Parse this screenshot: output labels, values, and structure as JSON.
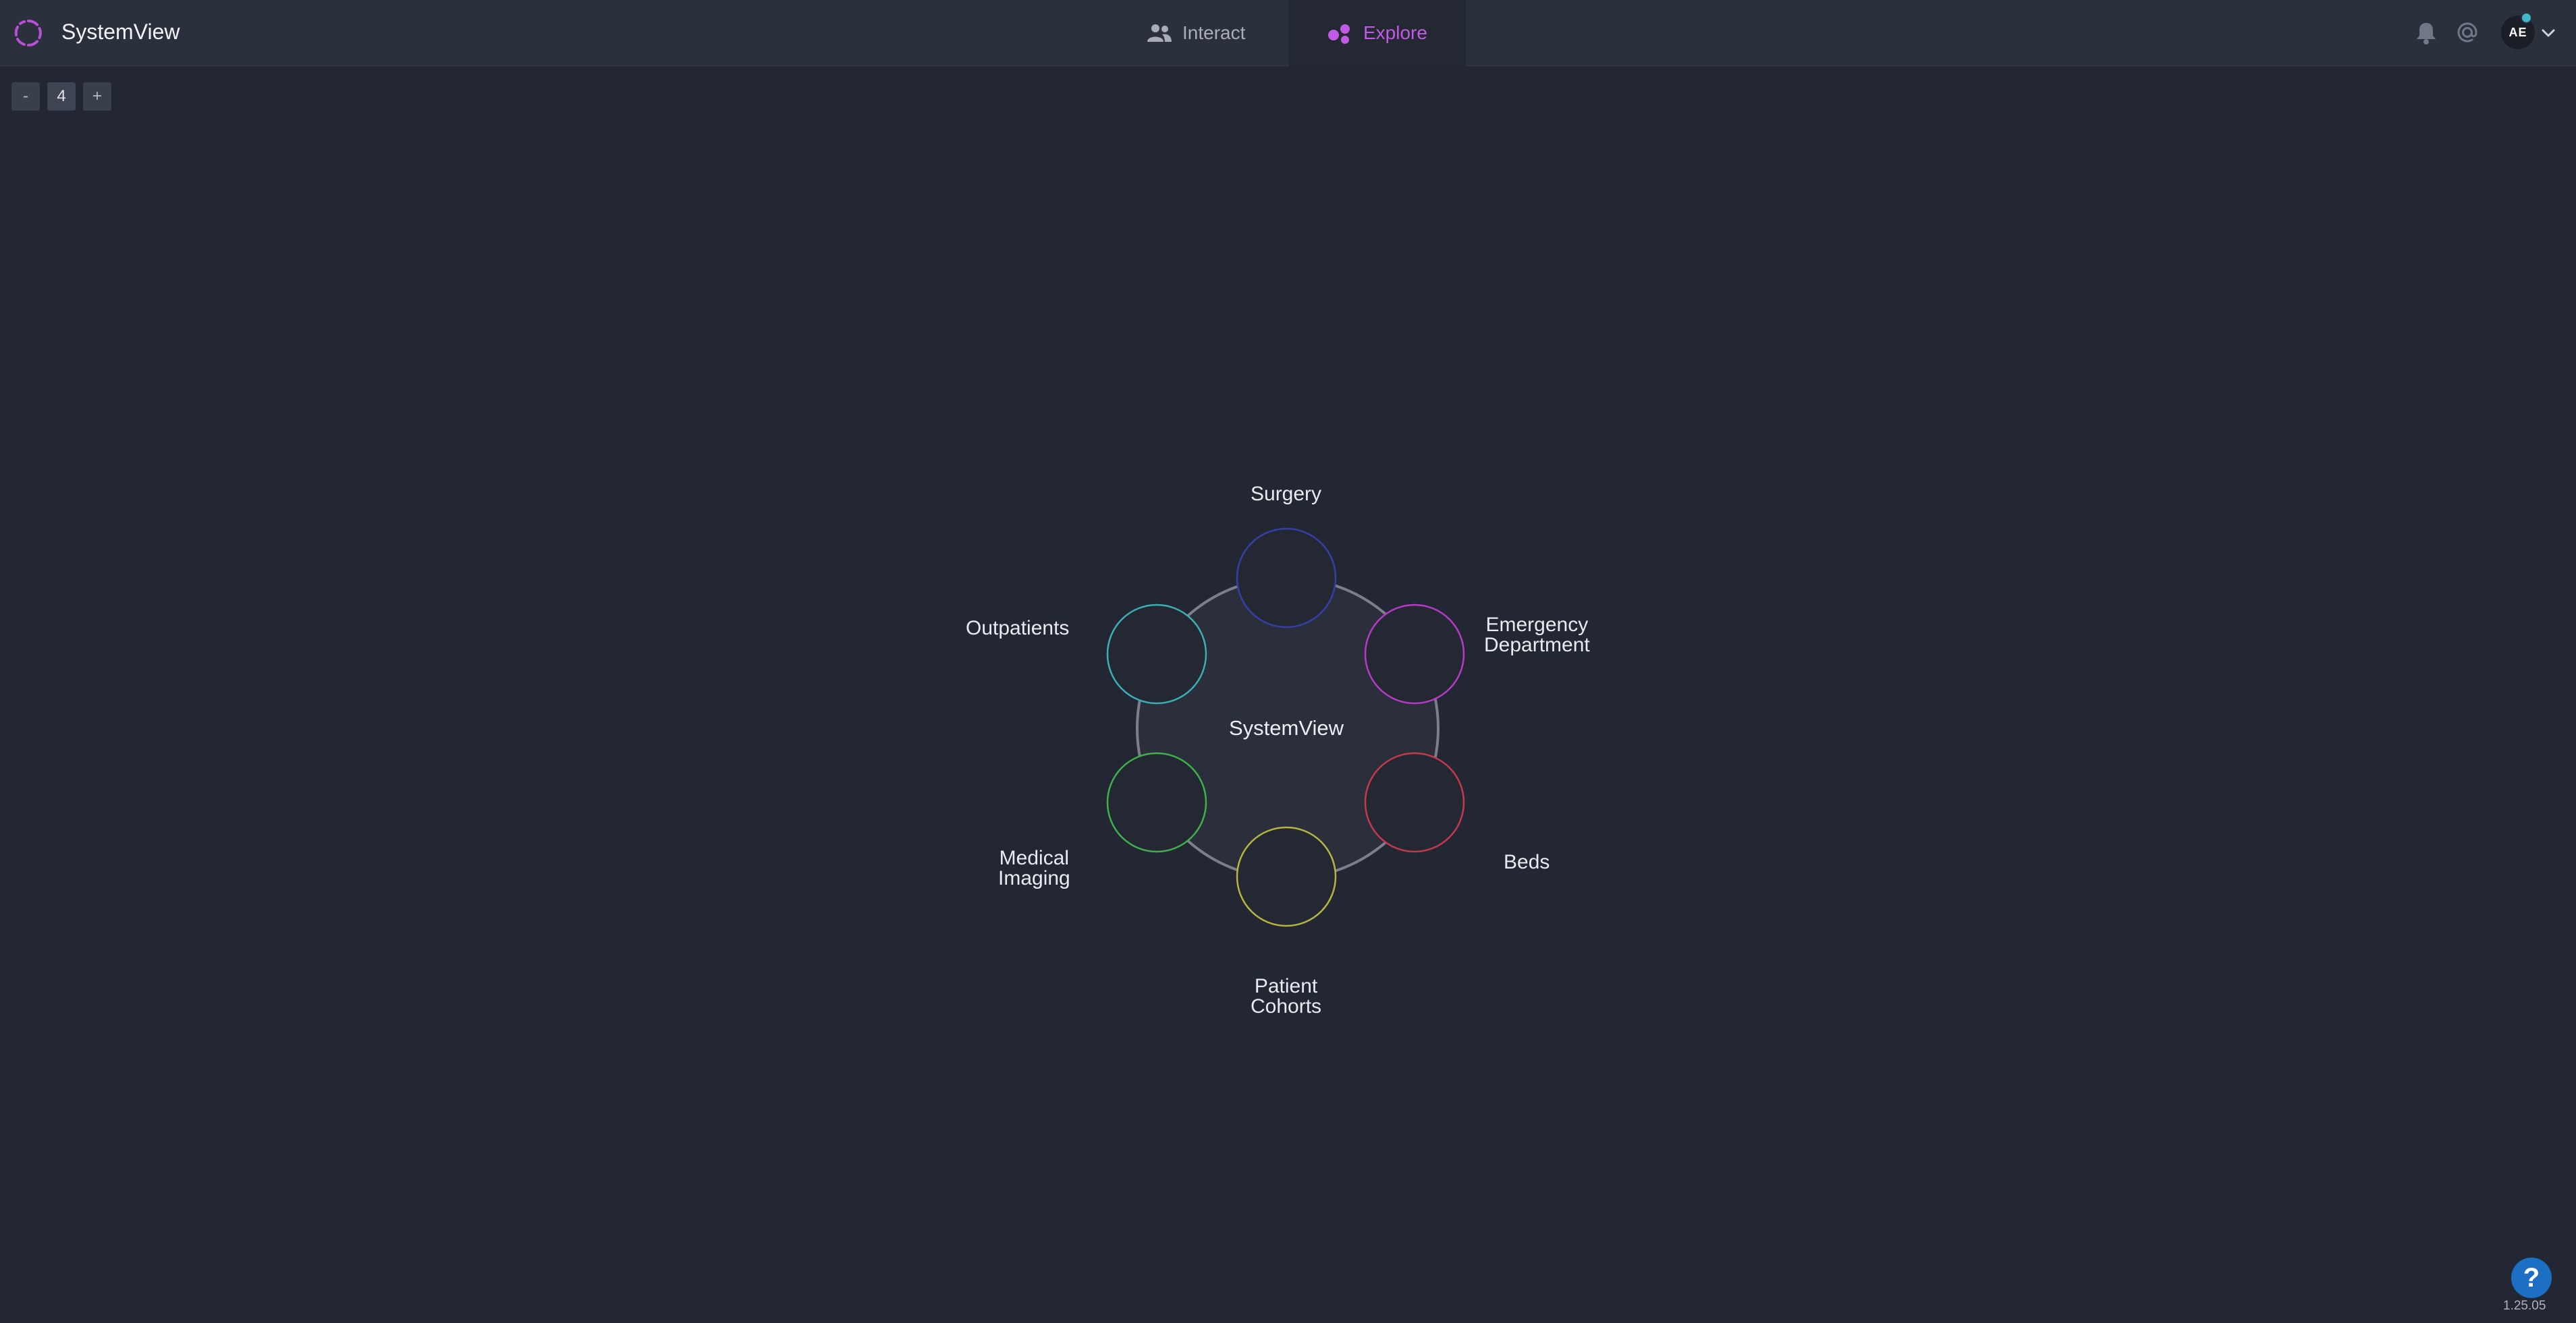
{
  "header": {
    "app_title": "SystemView",
    "tabs": [
      {
        "label": "Interact",
        "icon": "users-icon",
        "active": false
      },
      {
        "label": "Explore",
        "icon": "explore-icon",
        "active": true
      }
    ],
    "notifications_icon": "bell-icon",
    "mentions_icon": "at-icon",
    "user_initials": "AE",
    "accent_color": "#c15be6"
  },
  "zoom": {
    "minus_label": "-",
    "level": "4",
    "plus_label": "+"
  },
  "diagram": {
    "center_label": "SystemView",
    "nodes": [
      {
        "label": "Surgery",
        "color": "#3440a8"
      },
      {
        "label": "Emergency Department",
        "line1": "Emergency",
        "line2": "Department",
        "color": "#b53bc6"
      },
      {
        "label": "Beds",
        "color": "#c6394c"
      },
      {
        "label": "Patient Cohorts",
        "line1": "Patient",
        "line2": "Cohorts",
        "color": "#b5b640"
      },
      {
        "label": "Medical Imaging",
        "line1": "Medical",
        "line2": "Imaging",
        "color": "#3fb04b"
      },
      {
        "label": "Outpatients",
        "color": "#3bb0b4"
      }
    ]
  },
  "footer": {
    "help_label": "?",
    "version": "1.25.05"
  }
}
